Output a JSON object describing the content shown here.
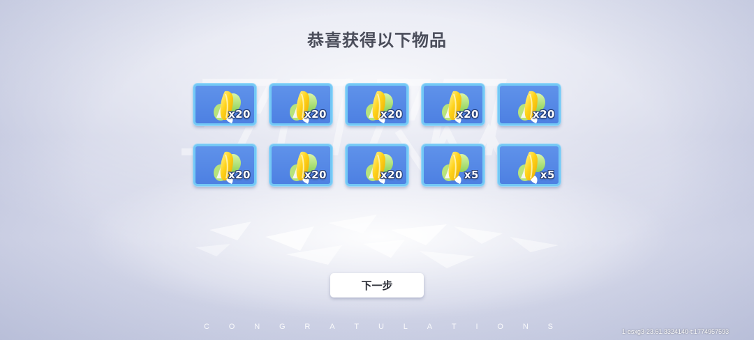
{
  "title": "恭喜获得以下物品",
  "rewards": [
    {
      "icon": "corn-icon",
      "quantity": "x20"
    },
    {
      "icon": "corn-icon",
      "quantity": "x20"
    },
    {
      "icon": "corn-icon",
      "quantity": "x20"
    },
    {
      "icon": "corn-icon",
      "quantity": "x20"
    },
    {
      "icon": "corn-icon",
      "quantity": "x20"
    },
    {
      "icon": "corn-icon",
      "quantity": "x20"
    },
    {
      "icon": "corn-icon",
      "quantity": "x20"
    },
    {
      "icon": "corn-icon",
      "quantity": "x20"
    },
    {
      "icon": "corn-icon",
      "quantity": "x5"
    },
    {
      "icon": "corn-icon",
      "quantity": "x5"
    }
  ],
  "next_button": {
    "label": "下一步"
  },
  "footer": {
    "congrats_letters": [
      "C",
      "O",
      "N",
      "G",
      "R",
      "A",
      "T",
      "U",
      "L",
      "A",
      "T",
      "I",
      "O",
      "N",
      "S"
    ],
    "build_id": "1-esxg3-23.61.3324140-t:1774957593"
  },
  "colors": {
    "slot_fill": "#5588e6",
    "slot_border": "#74c8f5",
    "title_text": "#4a4d5a"
  }
}
